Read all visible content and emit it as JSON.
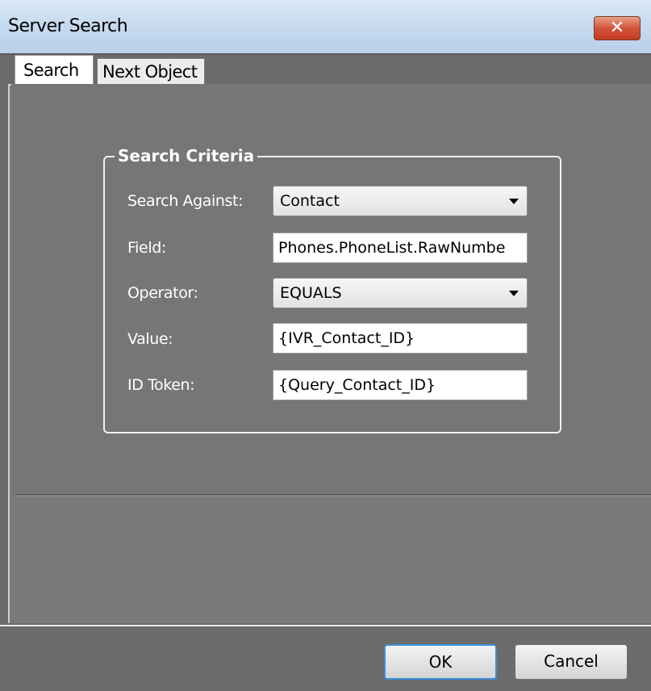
{
  "window": {
    "title": "Server Search",
    "close_icon": "close-icon"
  },
  "tabs": [
    {
      "label": "Search",
      "active": true
    },
    {
      "label": "Next Object",
      "active": false
    }
  ],
  "search_criteria": {
    "group_title": "Search Criteria",
    "search_against": {
      "label": "Search Against:",
      "value": "Contact"
    },
    "field": {
      "label": "Field:",
      "value": "Phones.PhoneList.RawNumbe"
    },
    "operator": {
      "label": "Operator:",
      "value": "EQUALS"
    },
    "value": {
      "label": "Value:",
      "value": "{IVR_Contact_ID}"
    },
    "id_token": {
      "label": "ID Token:",
      "value": "{Query_Contact_ID}"
    }
  },
  "buttons": {
    "ok": "OK",
    "cancel": "Cancel"
  },
  "colors": {
    "close_button": "#d3543a",
    "ok_focus_border": "#3c8fd8",
    "panel_background": "#767676"
  }
}
